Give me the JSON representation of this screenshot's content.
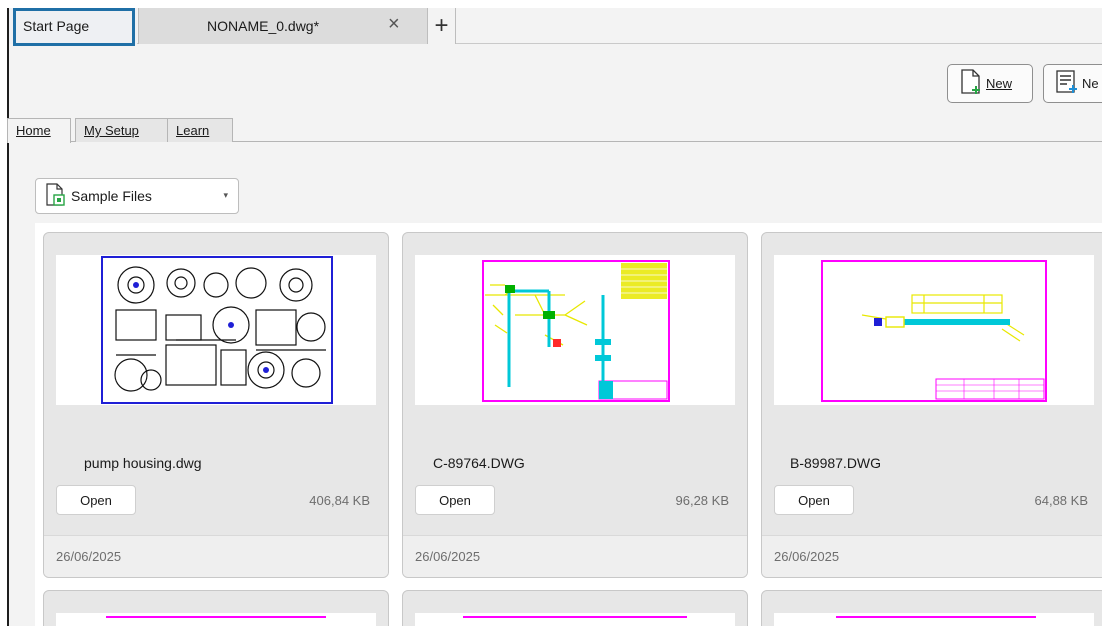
{
  "tabs": {
    "start": "Start Page",
    "file": "NONAME_0.dwg*",
    "close_glyph": "×",
    "add_glyph": "+"
  },
  "toolbar": {
    "new_label": "New",
    "new_sheet_label": "Ne",
    "new_icon": "new-document-icon",
    "new_sheet_icon": "new-sheet-icon"
  },
  "home_tabs": {
    "home": "Home",
    "my_setup": "My Setup",
    "learn": "Learn"
  },
  "sample_files": {
    "label": "Sample Files",
    "icon": "sample-files-icon",
    "caret_glyph": "▾"
  },
  "open_label": "Open",
  "files": [
    {
      "name": "pump housing.dwg",
      "size": "406,84 KB",
      "date": "26/06/2025",
      "border_color": "#1f1fd6"
    },
    {
      "name": "C-89764.DWG",
      "size": "96,28 KB",
      "date": "26/06/2025",
      "border_color": "#ff00ff"
    },
    {
      "name": "B-89987.DWG",
      "size": "64,88 KB",
      "date": "26/06/2025",
      "border_color": "#ff00ff"
    }
  ],
  "colors": {
    "highlight": "#1f6fa6",
    "cad_blue": "#1f1fd6",
    "cad_magenta": "#ff00ff",
    "cad_yellow": "#e8e800",
    "cad_cyan": "#00c8d8",
    "cad_green": "#00b000"
  }
}
